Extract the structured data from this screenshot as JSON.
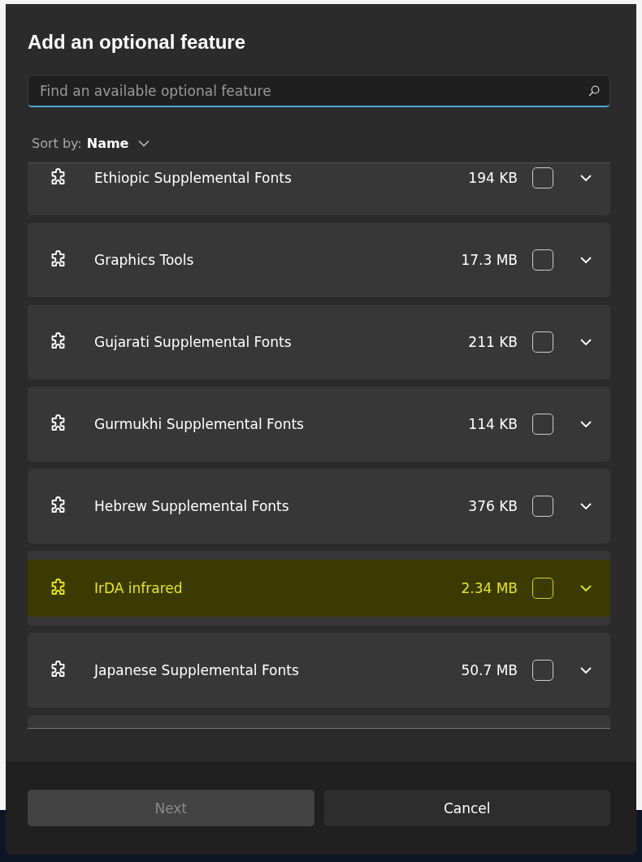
{
  "dialog": {
    "title": "Add an optional feature"
  },
  "search": {
    "placeholder": "Find an available optional feature"
  },
  "sort": {
    "label": "Sort by:",
    "value": "Name"
  },
  "features": [
    {
      "name": "Ethiopic Supplemental Fonts",
      "size": "194 KB",
      "checked": false,
      "highlighted": false
    },
    {
      "name": "Graphics Tools",
      "size": "17.3 MB",
      "checked": false,
      "highlighted": false
    },
    {
      "name": "Gujarati Supplemental Fonts",
      "size": "211 KB",
      "checked": false,
      "highlighted": false
    },
    {
      "name": "Gurmukhi Supplemental Fonts",
      "size": "114 KB",
      "checked": false,
      "highlighted": false
    },
    {
      "name": "Hebrew Supplemental Fonts",
      "size": "376 KB",
      "checked": false,
      "highlighted": false
    },
    {
      "name": "IrDA infrared",
      "size": "2.34 MB",
      "checked": false,
      "highlighted": true
    },
    {
      "name": "Japanese Supplemental Fonts",
      "size": "50.7 MB",
      "checked": false,
      "highlighted": false
    }
  ],
  "buttons": [
    {
      "label": "Next",
      "disabled": true
    },
    {
      "label": "Cancel",
      "disabled": false
    }
  ]
}
